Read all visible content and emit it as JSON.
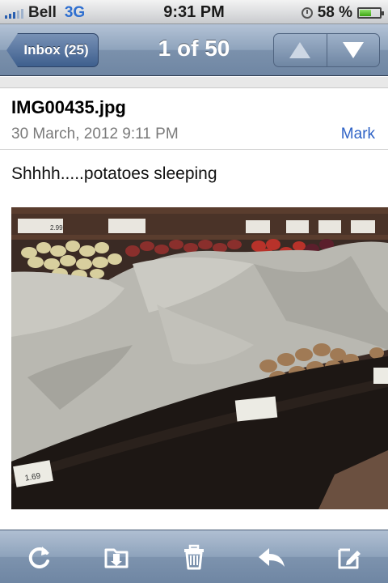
{
  "status_bar": {
    "carrier": "Bell",
    "network": "3G",
    "time": "9:31 PM",
    "battery": "58 %",
    "battery_level": 0.58
  },
  "nav": {
    "back_label": "Inbox (25)",
    "title": "1 of 50",
    "prev_icon": "up-arrow-icon",
    "next_icon": "down-arrow-icon"
  },
  "message": {
    "subject": "IMG00435.jpg",
    "date": "30 March, 2012 9:11 PM",
    "mark_label": "Mark",
    "body": "Shhhh.....potatoes sleeping",
    "photo_price_tags": [
      "2.99",
      "1.69",
      "1.69"
    ]
  },
  "toolbar": {
    "items": [
      "refresh-icon",
      "move-folder-icon",
      "trash-icon",
      "reply-icon",
      "compose-icon"
    ]
  },
  "colors": {
    "accent_link": "#2f63c6",
    "nav_blue": "#6f86a3"
  }
}
